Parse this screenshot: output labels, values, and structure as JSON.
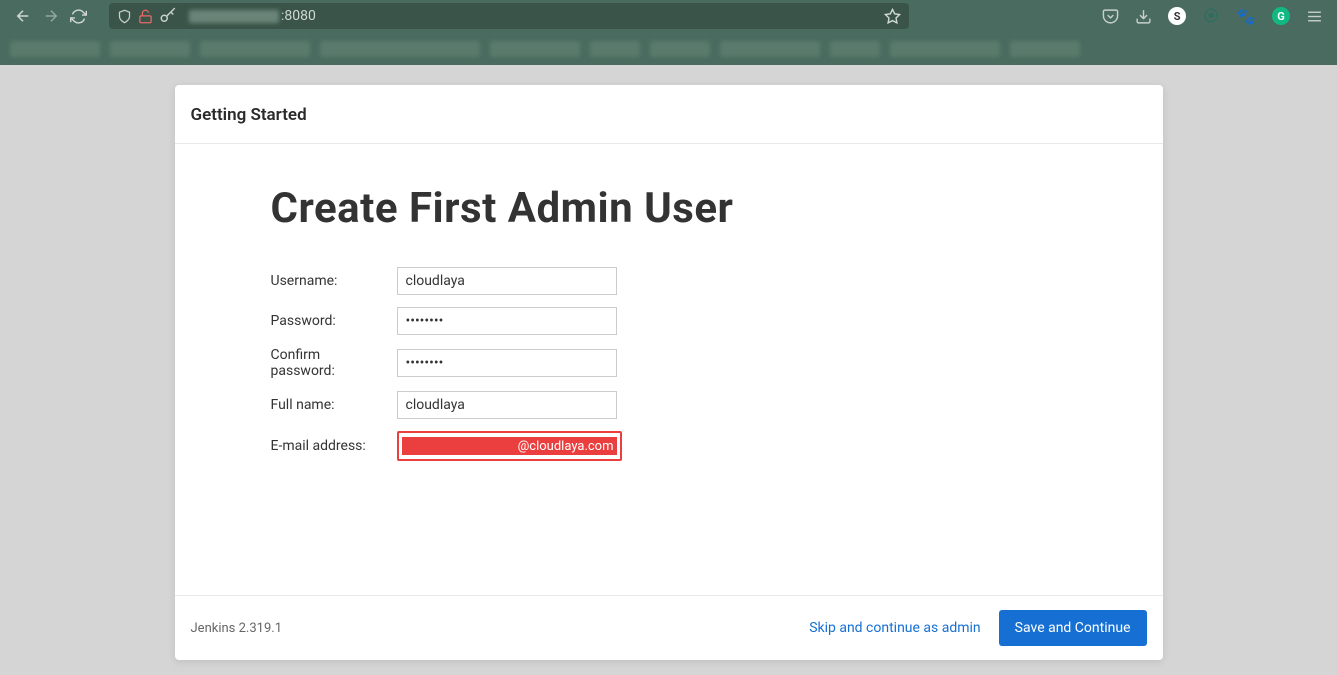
{
  "browser": {
    "url_port": ":8080"
  },
  "header": {
    "title": "Getting Started"
  },
  "main": {
    "heading": "Create First Admin User",
    "labels": {
      "username": "Username:",
      "password": "Password:",
      "confirm_password": "Confirm password:",
      "fullname": "Full name:",
      "email": "E-mail address:"
    },
    "values": {
      "username": "cloudlaya",
      "password": "••••••••",
      "confirm_password": "••••••••",
      "fullname": "cloudlaya",
      "email_suffix": "@cloudlaya.com"
    }
  },
  "footer": {
    "version": "Jenkins 2.319.1",
    "skip_label": "Skip and continue as admin",
    "save_label": "Save and Continue"
  }
}
